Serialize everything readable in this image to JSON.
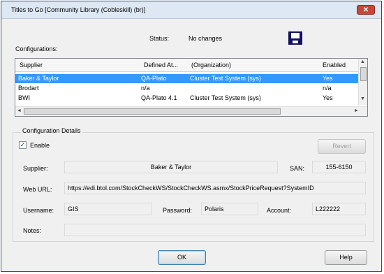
{
  "window": {
    "title": "Titles to Go [Community Library (Cobleskill) (br)]",
    "close_glyph": "✕"
  },
  "status": {
    "label": "Status:",
    "value": "No changes"
  },
  "configurations": {
    "label": "Configurations:",
    "columns": [
      "Supplier",
      "Defined At...",
      "(Organization)",
      "Enabled"
    ],
    "rows": [
      {
        "supplier": "Baker & Taylor",
        "defined_at": "QA-Plato",
        "organization": "Cluster Test System (sys)",
        "enabled": "Yes",
        "selected": true
      },
      {
        "supplier": "Brodart",
        "defined_at": "n/a",
        "organization": "",
        "enabled": "n/a",
        "selected": false
      },
      {
        "supplier": "BWI",
        "defined_at": "QA-Plato 4.1",
        "organization": "Cluster Test System (sys)",
        "enabled": "Yes",
        "selected": false
      }
    ]
  },
  "details": {
    "label": "Configuration Details",
    "enable_label": "Enable",
    "enable_checked": true,
    "revert_label": "Revert",
    "supplier_label": "Supplier:",
    "supplier_value": "Baker & Taylor",
    "san_label": "SAN:",
    "san_value": "155-6150",
    "url_label": "Web URL:",
    "url_value": "https://edi.btol.com/StockCheckWS/StockCheckWS.asmx/StockPriceRequest?SystemID",
    "username_label": "Username:",
    "username_value": "GIS",
    "password_label": "Password:",
    "password_value": "Polaris",
    "account_label": "Account:",
    "account_value": "L222222",
    "notes_label": "Notes:",
    "notes_value": ""
  },
  "buttons": {
    "ok": "OK",
    "help": "Help"
  },
  "icons": {
    "save": "save-icon",
    "check": "✓",
    "scroll_up": "▲",
    "scroll_down": "▼",
    "scroll_left": "◄",
    "scroll_right": "►"
  },
  "colors": {
    "selection": "#3399ff",
    "close": "#c9453a",
    "save_icon": "#12125e"
  }
}
